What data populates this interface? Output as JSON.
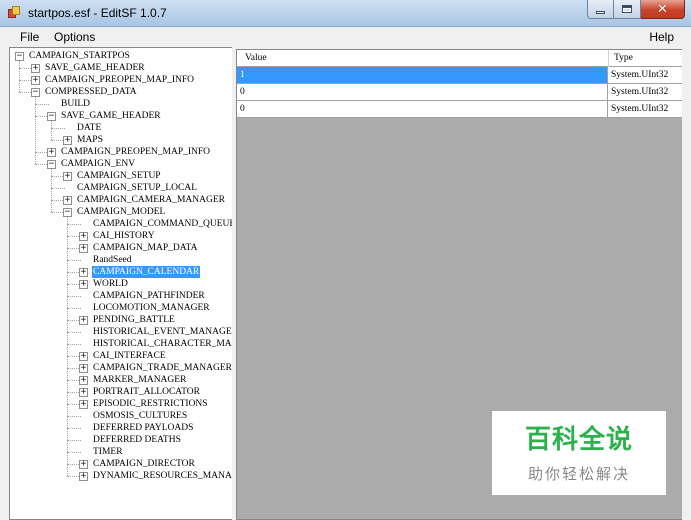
{
  "window": {
    "title": "startpos.esf - EditSF 1.0.7"
  },
  "menu": {
    "file": "File",
    "options": "Options",
    "help": "Help"
  },
  "tree": {
    "nodes": [
      {
        "label": "CAMPAIGN_STARTPOS",
        "depth": 0,
        "expander": "minus"
      },
      {
        "label": "SAVE_GAME_HEADER",
        "depth": 1,
        "expander": "plus"
      },
      {
        "label": "CAMPAIGN_PREOPEN_MAP_INFO",
        "depth": 1,
        "expander": "plus"
      },
      {
        "label": "COMPRESSED_DATA",
        "depth": 1,
        "expander": "minus"
      },
      {
        "label": "BUILD",
        "depth": 2,
        "expander": "none"
      },
      {
        "label": "SAVE_GAME_HEADER",
        "depth": 2,
        "expander": "minus"
      },
      {
        "label": "DATE",
        "depth": 3,
        "expander": "none"
      },
      {
        "label": "MAPS",
        "depth": 3,
        "expander": "plus"
      },
      {
        "label": "CAMPAIGN_PREOPEN_MAP_INFO",
        "depth": 2,
        "expander": "plus"
      },
      {
        "label": "CAMPAIGN_ENV",
        "depth": 2,
        "expander": "minus"
      },
      {
        "label": "CAMPAIGN_SETUP",
        "depth": 3,
        "expander": "plus"
      },
      {
        "label": "CAMPAIGN_SETUP_LOCAL",
        "depth": 3,
        "expander": "none"
      },
      {
        "label": "CAMPAIGN_CAMERA_MANAGER",
        "depth": 3,
        "expander": "plus"
      },
      {
        "label": "CAMPAIGN_MODEL",
        "depth": 3,
        "expander": "minus"
      },
      {
        "label": "CAMPAIGN_COMMAND_QUEUE_INDEX",
        "depth": 4,
        "expander": "none"
      },
      {
        "label": "CAI_HISTORY",
        "depth": 4,
        "expander": "plus"
      },
      {
        "label": "CAMPAIGN_MAP_DATA",
        "depth": 4,
        "expander": "plus"
      },
      {
        "label": "RandSeed",
        "depth": 4,
        "expander": "none"
      },
      {
        "label": "CAMPAIGN_CALENDAR",
        "depth": 4,
        "expander": "plus",
        "selected": true
      },
      {
        "label": "WORLD",
        "depth": 4,
        "expander": "plus"
      },
      {
        "label": "CAMPAIGN_PATHFINDER",
        "depth": 4,
        "expander": "none"
      },
      {
        "label": "LOCOMOTION_MANAGER",
        "depth": 4,
        "expander": "none"
      },
      {
        "label": "PENDING_BATTLE",
        "depth": 4,
        "expander": "plus"
      },
      {
        "label": "HISTORICAL_EVENT_MANAGER",
        "depth": 4,
        "expander": "none"
      },
      {
        "label": "HISTORICAL_CHARACTER_MANAGER",
        "depth": 4,
        "expander": "none"
      },
      {
        "label": "CAI_INTERFACE",
        "depth": 4,
        "expander": "plus"
      },
      {
        "label": "CAMPAIGN_TRADE_MANAGER",
        "depth": 4,
        "expander": "plus"
      },
      {
        "label": "MARKER_MANAGER",
        "depth": 4,
        "expander": "plus"
      },
      {
        "label": "PORTRAIT_ALLOCATOR",
        "depth": 4,
        "expander": "plus"
      },
      {
        "label": "EPISODIC_RESTRICTIONS",
        "depth": 4,
        "expander": "plus"
      },
      {
        "label": "OSMOSIS_CULTURES",
        "depth": 4,
        "expander": "none"
      },
      {
        "label": "DEFERRED PAYLOADS",
        "depth": 4,
        "expander": "none"
      },
      {
        "label": "DEFERRED DEATHS",
        "depth": 4,
        "expander": "none"
      },
      {
        "label": "TIMER",
        "depth": 4,
        "expander": "none"
      },
      {
        "label": "CAMPAIGN_DIRECTOR",
        "depth": 4,
        "expander": "plus"
      },
      {
        "label": "DYNAMIC_RESOURCES_MANAGER",
        "depth": 4,
        "expander": "plus"
      }
    ]
  },
  "grid": {
    "columns": {
      "value": "Value",
      "type": "Type"
    },
    "rows": [
      {
        "value": "1",
        "type": "System.UInt32",
        "selected": true
      },
      {
        "value": "0",
        "type": "System.UInt32"
      },
      {
        "value": "0",
        "type": "System.UInt32"
      }
    ]
  },
  "watermark": {
    "title": "百科全说",
    "subtitle": "助你轻松解决"
  },
  "colors": {
    "selection": "#3399ff",
    "grid_background": "#ababab",
    "watermark_green": "#2bb24c"
  },
  "icons": [
    "app-icon",
    "minimize-icon",
    "maximize-icon",
    "close-icon",
    "expand-plus-icon",
    "collapse-minus-icon"
  ]
}
